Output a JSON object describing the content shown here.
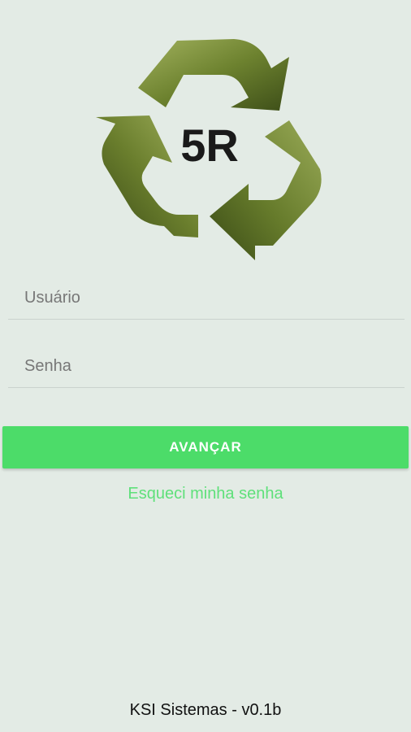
{
  "logo": {
    "text": "5R",
    "colors": {
      "dark": "#3f4f1a",
      "mid": "#6a7f2e",
      "light": "#9aab5a"
    }
  },
  "form": {
    "username_placeholder": "Usuário",
    "password_placeholder": "Senha",
    "submit_label": "AVANÇAR",
    "forgot_label": "Esqueci minha senha"
  },
  "footer": {
    "text": "KSI Sistemas - v0.1b"
  },
  "colors": {
    "accent": "#4cdc69",
    "link": "#5fe07a",
    "background": "#e3ebe5"
  }
}
